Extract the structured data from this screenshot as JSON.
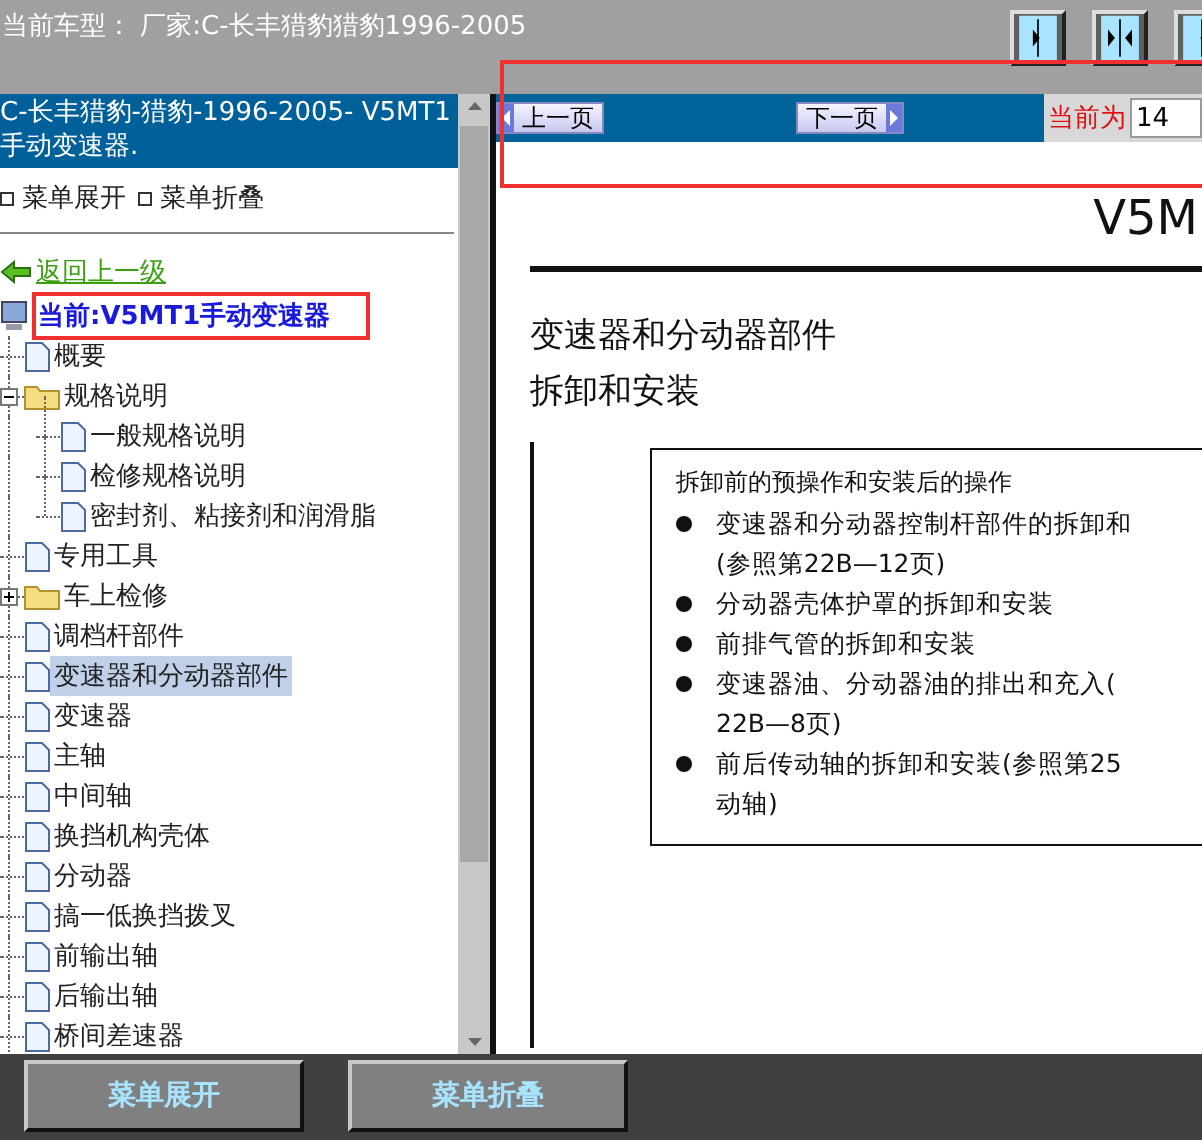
{
  "top_bar": {
    "title": "当前车型： 厂家:C-长丰猎豹猎豹1996-2005",
    "icon_buttons": [
      {
        "kind": "right"
      },
      {
        "kind": "both"
      },
      {
        "kind": "left"
      }
    ]
  },
  "sidebar": {
    "header": "C-长丰猎豹-猎豹-1996-2005- V5MT1手动变速器.",
    "menu_links": [
      "菜单展开",
      "菜单折叠"
    ],
    "back_link": "返回上一级",
    "current": "当前:V5MT1手动变速器",
    "tree": [
      {
        "label": "概要",
        "kind": "doc",
        "selected": false
      },
      {
        "label": "规格说明",
        "kind": "folder",
        "expanded": true,
        "selected": false,
        "children": [
          {
            "label": "一般规格说明",
            "kind": "doc",
            "selected": false
          },
          {
            "label": "检修规格说明",
            "kind": "doc",
            "selected": false
          },
          {
            "label": "密封剂、粘接剂和润滑脂",
            "kind": "doc",
            "selected": false
          }
        ]
      },
      {
        "label": "专用工具",
        "kind": "doc",
        "selected": false
      },
      {
        "label": "车上检修",
        "kind": "folder",
        "expanded": false,
        "selected": false
      },
      {
        "label": "调档杆部件",
        "kind": "doc",
        "selected": false
      },
      {
        "label": "变速器和分动器部件",
        "kind": "doc",
        "selected": true
      },
      {
        "label": "变速器",
        "kind": "doc",
        "selected": false
      },
      {
        "label": "主轴",
        "kind": "doc",
        "selected": false
      },
      {
        "label": "中间轴",
        "kind": "doc",
        "selected": false
      },
      {
        "label": "换挡机构壳体",
        "kind": "doc",
        "selected": false
      },
      {
        "label": "分动器",
        "kind": "doc",
        "selected": false
      },
      {
        "label": "搞一低换挡拨叉",
        "kind": "doc",
        "selected": false
      },
      {
        "label": "前输出轴",
        "kind": "doc",
        "selected": false
      },
      {
        "label": "后输出轴",
        "kind": "doc",
        "selected": false
      },
      {
        "label": "桥间差速器",
        "kind": "doc",
        "selected": false
      }
    ]
  },
  "nav": {
    "prev": "上一页",
    "next": "下一页",
    "page_label": "当前为",
    "page_value": "14"
  },
  "document": {
    "corner_title": "V5M",
    "heading": "变速器和分动器部件",
    "subheading": "拆卸和安装",
    "box_title": "拆卸前的预操作和安装后的操作",
    "bullets": [
      {
        "lines": [
          "变速器和分动器控制杆部件的拆卸和",
          "(参照第22B—12页)"
        ]
      },
      {
        "lines": [
          "分动器壳体护罩的拆卸和安装"
        ]
      },
      {
        "lines": [
          "前排气管的拆卸和安装"
        ]
      },
      {
        "lines": [
          "变速器油、分动器油的排出和充入(",
          "22B—8页)"
        ]
      },
      {
        "lines": [
          "前后传动轴的拆卸和安装(参照第25",
          "动轴)"
        ]
      }
    ]
  },
  "bottom_buttons": [
    "菜单展开",
    "菜单折叠"
  ]
}
